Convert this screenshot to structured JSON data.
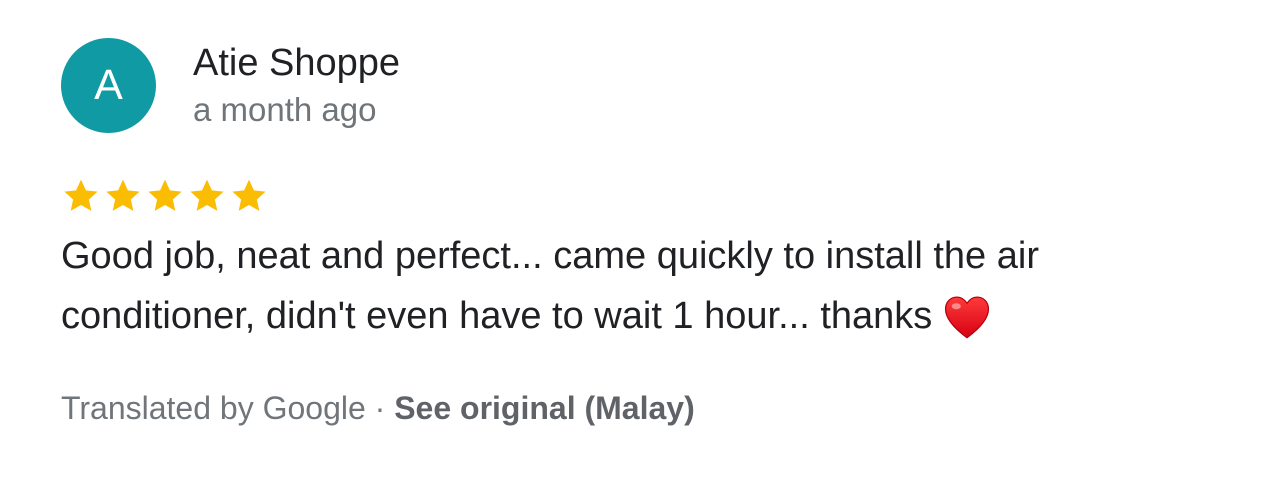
{
  "review": {
    "avatar_letter": "A",
    "avatar_color": "#0f9aa4",
    "author_name": "Atie Shoppe",
    "time_ago": "a month ago",
    "rating": 5,
    "rating_max": 5,
    "star_color": "#fbbc04",
    "text": "Good job, neat and perfect... came quickly to install the air conditioner, didn't even have to wait 1 hour... thanks",
    "text_emoji_icon": "red-heart-icon",
    "translation": {
      "translated_by": "Translated by Google",
      "separator": "·",
      "see_original": "See original (Malay)"
    }
  }
}
